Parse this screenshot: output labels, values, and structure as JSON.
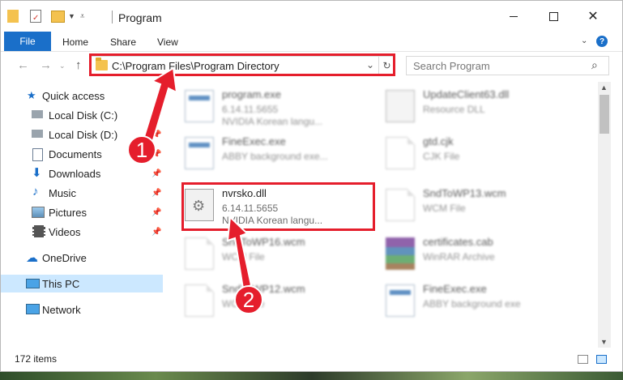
{
  "window": {
    "title": "Program"
  },
  "ribbon": {
    "tabs": [
      "File",
      "Home",
      "Share",
      "View"
    ]
  },
  "address": {
    "path": "C:\\Program Files\\Program Directory"
  },
  "search": {
    "placeholder": "Search Program"
  },
  "sidebar": {
    "items": [
      {
        "label": "Quick access",
        "icon": "star-icon"
      },
      {
        "label": "Local Disk (C:)",
        "icon": "drive-icon"
      },
      {
        "label": "Local Disk (D:)",
        "icon": "drive-icon"
      },
      {
        "label": "Documents",
        "icon": "documents-icon"
      },
      {
        "label": "Downloads",
        "icon": "download-icon"
      },
      {
        "label": "Music",
        "icon": "music-icon"
      },
      {
        "label": "Pictures",
        "icon": "pictures-icon"
      },
      {
        "label": "Videos",
        "icon": "videos-icon"
      },
      {
        "label": "OneDrive",
        "icon": "cloud-icon"
      },
      {
        "label": "This PC",
        "icon": "computer-icon"
      },
      {
        "label": "Network",
        "icon": "network-icon"
      }
    ]
  },
  "files": [
    {
      "name": "program.exe",
      "line1": "6.14.11.5655",
      "line2": "NVIDIA Korean langu..."
    },
    {
      "name": "UpdateClient63.dll",
      "line1": "Resource DLL",
      "line2": ""
    },
    {
      "name": "FineExec.exe",
      "line1": "ABBY background exe...",
      "line2": ""
    },
    {
      "name": "gtd.cjk",
      "line1": "CJK File",
      "line2": ""
    },
    {
      "name": "nvrsko.dll",
      "line1": "6.14.11.5655",
      "line2": "NVIDIA Korean langu..."
    },
    {
      "name": "SndToWP13.wcm",
      "line1": "WCM File",
      "line2": ""
    },
    {
      "name": "SndToWP16.wcm",
      "line1": "WCM File",
      "line2": ""
    },
    {
      "name": "certificates.cab",
      "line1": "WinRAR Archive",
      "line2": ""
    },
    {
      "name": "SndToWP12.wcm",
      "line1": "WCM File",
      "line2": ""
    },
    {
      "name": "FineExec.exe",
      "line1": "ABBY background exe",
      "line2": ""
    }
  ],
  "status": {
    "count": "172 items"
  },
  "annotations": {
    "step1": "1",
    "step2": "2"
  },
  "colors": {
    "accent": "#1a6fc9",
    "highlight": "#e51e2c",
    "selected": "#cce8ff"
  }
}
